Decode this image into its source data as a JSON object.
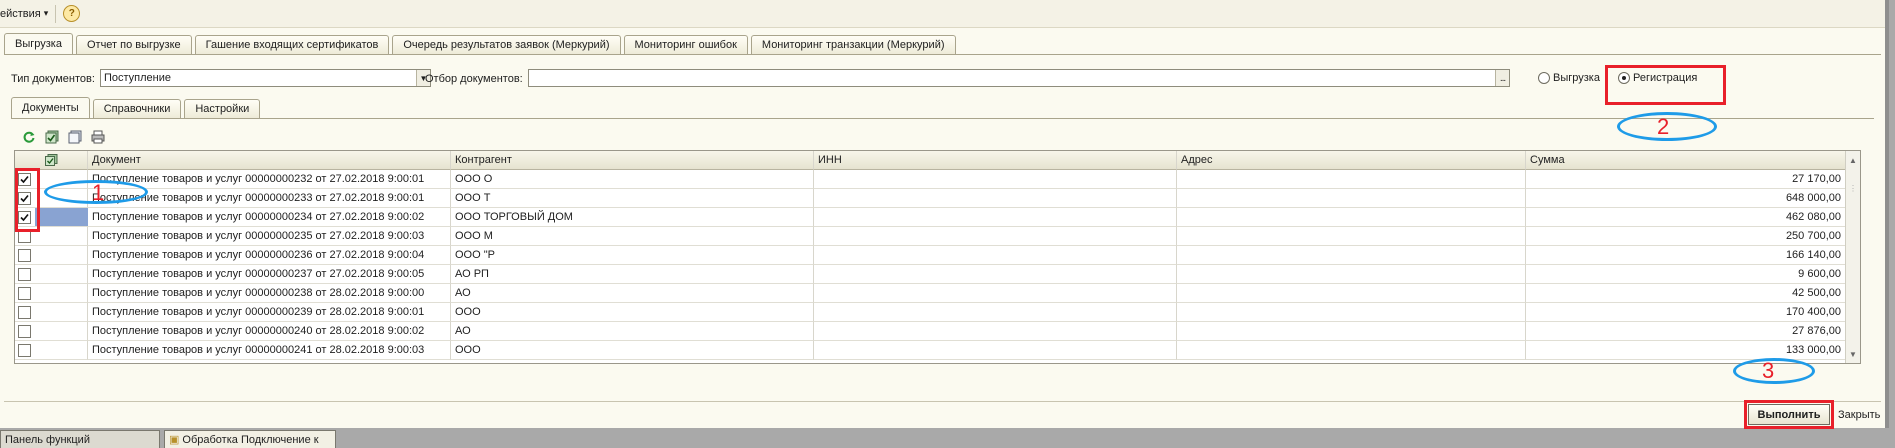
{
  "menubar": {
    "actions_label": "ействия",
    "actions_arrow": "▾",
    "help_label": "?"
  },
  "tabs": [
    {
      "label": "Выгрузка",
      "active": true
    },
    {
      "label": "Отчет по выгрузке",
      "active": false
    },
    {
      "label": "Гашение входящих сертификатов",
      "active": false
    },
    {
      "label": "Очередь результатов заявок (Меркурий)",
      "active": false
    },
    {
      "label": "Мониторинг ошибок",
      "active": false
    },
    {
      "label": "Мониторинг транзакции (Меркурий)",
      "active": false
    }
  ],
  "filter": {
    "doc_type_label": "Тип документов:",
    "doc_type_value": "Поступление",
    "doc_filter_label": "Отбор документов:",
    "doc_filter_value": "",
    "doc_filter_btn": "...",
    "dropdown_arrow": "▼"
  },
  "mode_options": [
    {
      "label": "Выгрузка",
      "selected": false
    },
    {
      "label": "Регистрация",
      "selected": true
    }
  ],
  "subtabs": [
    {
      "label": "Документы",
      "active": true
    },
    {
      "label": "Справочники",
      "active": false
    },
    {
      "label": "Настройки",
      "active": false
    }
  ],
  "toolbar_icons": [
    "refresh-icon",
    "check-all-icon",
    "uncheck-all-icon",
    "print-icon"
  ],
  "table": {
    "columns": [
      "Документ",
      "Контрагент",
      "ИНН",
      "Адрес",
      "Сумма"
    ],
    "rows": [
      {
        "checked": true,
        "doc": "Поступление товаров и услуг 00000000232 от 27.02.2018 9:00:01",
        "contractor": "ООО   О",
        "inn": "",
        "address": "",
        "sum": "27 170,00"
      },
      {
        "checked": true,
        "doc": "Поступление товаров и услуг 00000000233 от 27.02.2018 9:00:01",
        "contractor": "ООО   Т",
        "inn": "",
        "address": "",
        "sum": "648 000,00"
      },
      {
        "checked": true,
        "doc": "Поступление товаров и услуг 00000000234 от 27.02.2018 9:00:02",
        "contractor": "ООО  ТОРГОВЫЙ ДОМ",
        "inn": "",
        "address": "",
        "sum": "462 080,00"
      },
      {
        "checked": false,
        "doc": "Поступление товаров и услуг 00000000235 от 27.02.2018 9:00:03",
        "contractor": "ООО  М",
        "inn": "",
        "address": "",
        "sum": "250 700,00"
      },
      {
        "checked": false,
        "doc": "Поступление товаров и услуг 00000000236 от 27.02.2018 9:00:04",
        "contractor": "ООО   \"Р",
        "inn": "",
        "address": "",
        "sum": "166 140,00"
      },
      {
        "checked": false,
        "doc": "Поступление товаров и услуг 00000000237 от 27.02.2018 9:00:05",
        "contractor": "АО  РП",
        "inn": "",
        "address": "",
        "sum": "9 600,00"
      },
      {
        "checked": false,
        "doc": "Поступление товаров и услуг 00000000238 от 28.02.2018 9:00:00",
        "contractor": "АО",
        "inn": "",
        "address": "",
        "sum": "42 500,00"
      },
      {
        "checked": false,
        "doc": "Поступление товаров и услуг 00000000239 от 28.02.2018 9:00:01",
        "contractor": "ООО",
        "inn": "",
        "address": "",
        "sum": "170 400,00"
      },
      {
        "checked": false,
        "doc": "Поступление товаров и услуг 00000000240 от 28.02.2018 9:00:02",
        "contractor": "АО",
        "inn": "",
        "address": "",
        "sum": "27 876,00"
      },
      {
        "checked": false,
        "doc": "Поступление товаров и услуг 00000000241 от 28.02.2018 9:00:03",
        "contractor": "ООО",
        "inn": "",
        "address": "",
        "sum": "133 000,00"
      }
    ]
  },
  "buttons": {
    "run": "Выполнить",
    "close": "Закрыть"
  },
  "taskbar": [
    {
      "label": "Панель функций",
      "active": false
    },
    {
      "label": "Обработка  Подключение к",
      "active": true
    }
  ],
  "annotations": [
    "1",
    "2",
    "3"
  ],
  "colors": {
    "annotation_red": "#e8202a",
    "annotation_blue": "#1e9be8",
    "selection": "#89a3d2"
  }
}
